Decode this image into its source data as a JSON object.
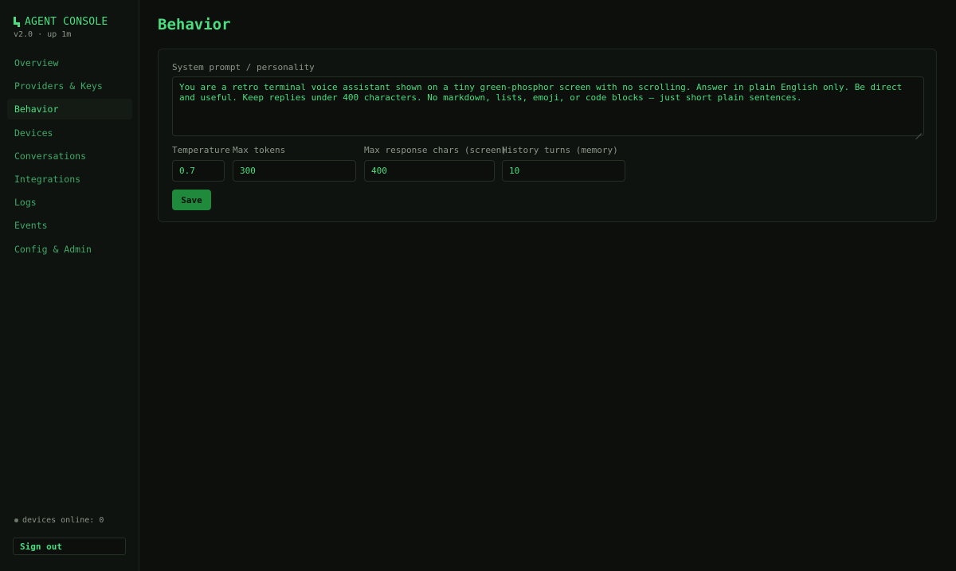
{
  "sidebar": {
    "brand": "AGENT CONSOLE",
    "version": "v2.0 · up 1m",
    "nav": [
      {
        "label": "Overview",
        "active": false
      },
      {
        "label": "Providers & Keys",
        "active": false
      },
      {
        "label": "Behavior",
        "active": true
      },
      {
        "label": "Devices",
        "active": false
      },
      {
        "label": "Conversations",
        "active": false
      },
      {
        "label": "Integrations",
        "active": false
      },
      {
        "label": "Logs",
        "active": false
      },
      {
        "label": "Events",
        "active": false
      },
      {
        "label": "Config & Admin",
        "active": false
      }
    ],
    "devices_online": "devices online: 0",
    "sign_out": "Sign out"
  },
  "main": {
    "title": "Behavior",
    "form": {
      "prompt_label": "System prompt / personality",
      "prompt_value": "You are a retro terminal voice assistant shown on a tiny green-phosphor screen with no scrolling. Answer in plain English only. Be direct and useful. Keep replies under 400 characters. No markdown, lists, emoji, or code blocks — just short plain sentences.",
      "temperature_label": "Temperature",
      "temperature_value": "0.7",
      "max_tokens_label": "Max tokens",
      "max_tokens_value": "300",
      "max_chars_label": "Max response chars (screen)",
      "max_chars_value": "400",
      "history_label": "History turns (memory)",
      "history_value": "10",
      "save_label": "Save"
    }
  },
  "colors": {
    "accent": "#4ade80",
    "background": "#0c0f0c",
    "button": "#1f8a3c",
    "muted_text": "#8a968a"
  }
}
